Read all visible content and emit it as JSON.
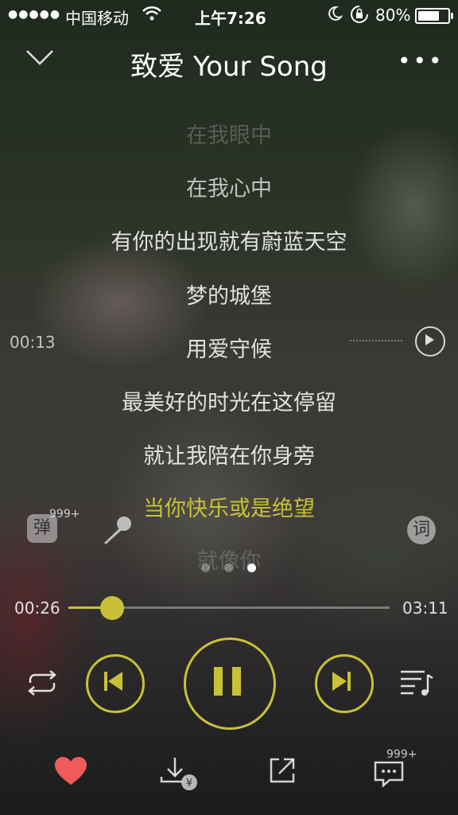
{
  "status_bar": {
    "signal": "●●●●●",
    "carrier": "中国移动",
    "time": "上午7:26",
    "battery_percent": "80%",
    "battery_level": 0.8
  },
  "header": {
    "title": "致爱 Your Song",
    "more": "•••"
  },
  "lyrics": [
    {
      "text": "在我眼中",
      "state": "faded"
    },
    {
      "text": "在我心中",
      "state": "dim"
    },
    {
      "text": "有你的出现就有蔚蓝天空",
      "state": "normal"
    },
    {
      "text": "梦的城堡",
      "state": "normal"
    },
    {
      "text": "用爱守候",
      "state": "normal"
    },
    {
      "text": "最美好的时光在这停留",
      "state": "normal"
    },
    {
      "text": "就让我陪在你身旁",
      "state": "normal"
    },
    {
      "text": "当你快乐或是绝望",
      "state": "active"
    },
    {
      "text": "就像你",
      "state": "faded"
    }
  ],
  "lyric_seek": {
    "time": "00:13"
  },
  "side_buttons": {
    "danmu_label": "弹",
    "danmu_count": "999+",
    "lyric_label": "词"
  },
  "pager": {
    "count": 3,
    "active_index": 2
  },
  "progress": {
    "current": "00:26",
    "total": "03:11",
    "fraction": 0.136
  },
  "bottom_bar": {
    "comment_count": "999+"
  },
  "colors": {
    "accent": "#c8c137",
    "heart": "#f05a5a"
  }
}
